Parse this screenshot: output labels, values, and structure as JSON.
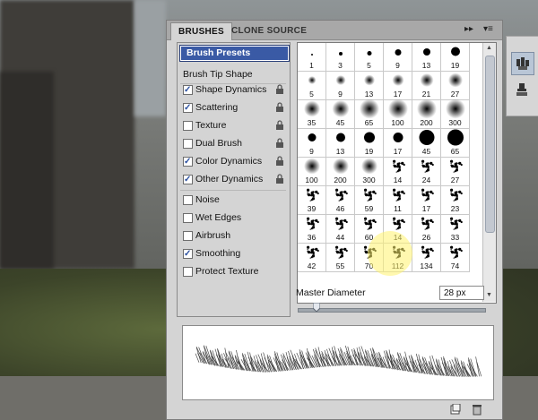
{
  "panel": {
    "tabs": [
      {
        "label": "BRUSHES"
      },
      {
        "label": "CLONE SOURCE"
      }
    ],
    "menu_icons": [
      "expand-arrows-icon",
      "panel-menu-icon"
    ]
  },
  "options": {
    "brush_presets": "Brush Presets",
    "brush_tip_shape": "Brush Tip Shape",
    "items": [
      {
        "label": "Shape Dynamics",
        "checked": true
      },
      {
        "label": "Scattering",
        "checked": true
      },
      {
        "label": "Texture",
        "checked": false
      },
      {
        "label": "Dual Brush",
        "checked": false
      },
      {
        "label": "Color Dynamics",
        "checked": true
      },
      {
        "label": "Other Dynamics",
        "checked": true
      },
      {
        "label": "Noise",
        "checked": false
      },
      {
        "label": "Wet Edges",
        "checked": false
      },
      {
        "label": "Airbrush",
        "checked": false
      },
      {
        "label": "Smoothing",
        "checked": true
      },
      {
        "label": "Protect Texture",
        "checked": false
      }
    ]
  },
  "brushes": {
    "rows": [
      [
        "1",
        "3",
        "5",
        "9",
        "13",
        "19"
      ],
      [
        "5",
        "9",
        "13",
        "17",
        "21",
        "27"
      ],
      [
        "35",
        "45",
        "65",
        "100",
        "200",
        "300"
      ],
      [
        "9",
        "13",
        "19",
        "17",
        "45",
        "65"
      ],
      [
        "100",
        "200",
        "300",
        "14",
        "24",
        "27"
      ],
      [
        "39",
        "46",
        "59",
        "11",
        "17",
        "23"
      ],
      [
        "36",
        "44",
        "60",
        "14",
        "26",
        "33"
      ],
      [
        "42",
        "55",
        "70",
        "112",
        "134",
        "74"
      ]
    ]
  },
  "master_diameter": {
    "label": "Master Diameter",
    "value": "28 px",
    "slider_fraction": 0.1
  }
}
